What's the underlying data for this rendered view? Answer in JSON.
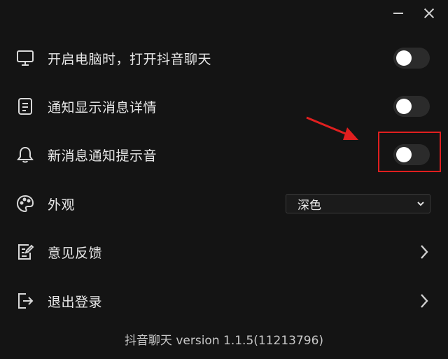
{
  "window": {
    "minimize_icon": "minimize-icon",
    "close_icon": "close-icon"
  },
  "settings": [
    {
      "icon": "monitor-icon",
      "label": "开启电脑时，打开抖音聊天",
      "control": "toggle",
      "on": false
    },
    {
      "icon": "document-icon",
      "label": "通知显示消息详情",
      "control": "toggle",
      "on": false
    },
    {
      "icon": "bell-icon",
      "label": "新消息通知提示音",
      "control": "toggle",
      "on": false
    },
    {
      "icon": "palette-icon",
      "label": "外观",
      "control": "select",
      "value": "深色"
    },
    {
      "icon": "feedback-icon",
      "label": "意见反馈",
      "control": "link"
    },
    {
      "icon": "logout-icon",
      "label": "退出登录",
      "control": "link"
    }
  ],
  "annotation": {
    "highlight_color": "#e01f1f"
  },
  "footer": {
    "version_text": "抖音聊天 version 1.1.5(11213796)"
  }
}
